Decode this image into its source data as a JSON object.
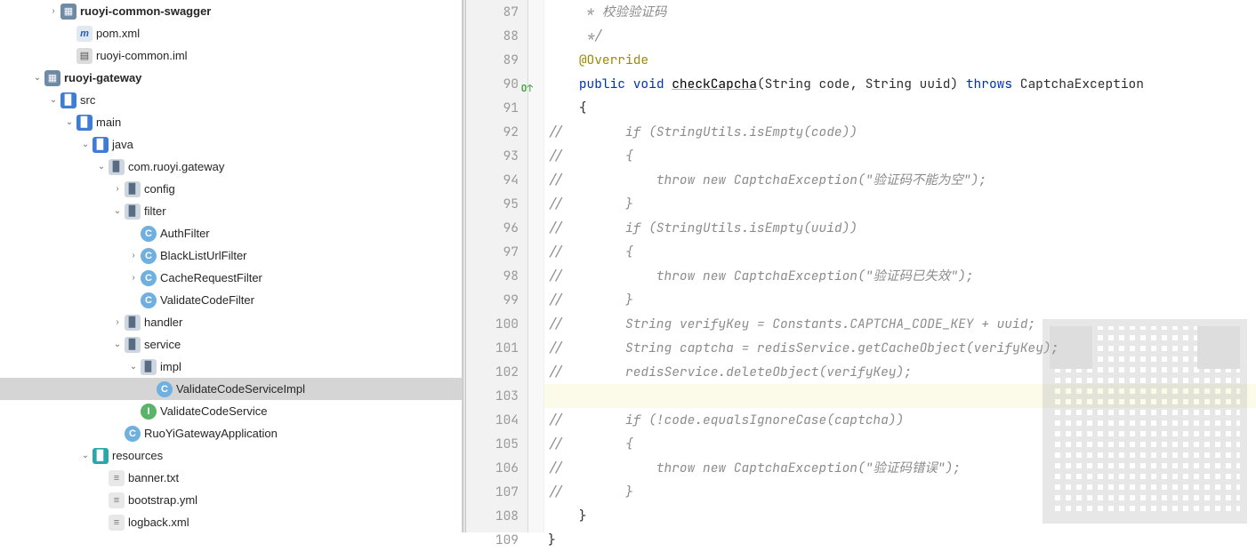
{
  "tree": {
    "nodes": [
      {
        "indent": 52,
        "arrow": "right",
        "icon": "folder-mod",
        "glyph": "▦",
        "label": "ruoyi-common-swagger",
        "bold": true,
        "interact": true
      },
      {
        "indent": 70,
        "arrow": "",
        "icon": "maven",
        "glyph": "m",
        "label": "pom.xml",
        "interact": true
      },
      {
        "indent": 70,
        "arrow": "",
        "icon": "iml",
        "glyph": "▤",
        "label": "ruoyi-common.iml",
        "interact": true
      },
      {
        "indent": 34,
        "arrow": "down",
        "icon": "folder-mod",
        "glyph": "▦",
        "label": "ruoyi-gateway",
        "bold": true,
        "interact": true
      },
      {
        "indent": 52,
        "arrow": "down",
        "icon": "folder-blue",
        "glyph": "▉",
        "label": "src",
        "interact": true
      },
      {
        "indent": 70,
        "arrow": "down",
        "icon": "folder-blue",
        "glyph": "▉",
        "label": "main",
        "interact": true
      },
      {
        "indent": 88,
        "arrow": "down",
        "icon": "folder-blue",
        "glyph": "▉",
        "label": "java",
        "interact": true
      },
      {
        "indent": 106,
        "arrow": "down",
        "icon": "folder",
        "glyph": "▉",
        "label": "com.ruoyi.gateway",
        "interact": true
      },
      {
        "indent": 124,
        "arrow": "right",
        "icon": "folder",
        "glyph": "▉",
        "label": "config",
        "interact": true
      },
      {
        "indent": 124,
        "arrow": "down",
        "icon": "folder",
        "glyph": "▉",
        "label": "filter",
        "interact": true
      },
      {
        "indent": 142,
        "arrow": "",
        "icon": "class-c",
        "glyph": "C",
        "label": "AuthFilter",
        "interact": true
      },
      {
        "indent": 142,
        "arrow": "right",
        "icon": "class-c",
        "glyph": "C",
        "label": "BlackListUrlFilter",
        "interact": true
      },
      {
        "indent": 142,
        "arrow": "right",
        "icon": "class-c",
        "glyph": "C",
        "label": "CacheRequestFilter",
        "interact": true
      },
      {
        "indent": 142,
        "arrow": "",
        "icon": "class-c",
        "glyph": "C",
        "label": "ValidateCodeFilter",
        "interact": true
      },
      {
        "indent": 124,
        "arrow": "right",
        "icon": "folder",
        "glyph": "▉",
        "label": "handler",
        "interact": true
      },
      {
        "indent": 124,
        "arrow": "down",
        "icon": "folder",
        "glyph": "▉",
        "label": "service",
        "interact": true
      },
      {
        "indent": 142,
        "arrow": "down",
        "icon": "folder",
        "glyph": "▉",
        "label": "impl",
        "interact": true
      },
      {
        "indent": 160,
        "arrow": "",
        "icon": "class-c",
        "glyph": "C",
        "label": "ValidateCodeServiceImpl",
        "interact": true,
        "selected": true
      },
      {
        "indent": 142,
        "arrow": "",
        "icon": "interface",
        "glyph": "I",
        "label": "ValidateCodeService",
        "interact": true
      },
      {
        "indent": 124,
        "arrow": "",
        "icon": "class-c",
        "glyph": "C",
        "label": "RuoYiGatewayApplication",
        "interact": true
      },
      {
        "indent": 88,
        "arrow": "down",
        "icon": "folder-teal",
        "glyph": "▉",
        "label": "resources",
        "interact": true
      },
      {
        "indent": 106,
        "arrow": "",
        "icon": "txt",
        "glyph": "≡",
        "label": "banner.txt",
        "interact": true
      },
      {
        "indent": 106,
        "arrow": "",
        "icon": "yml",
        "glyph": "≡",
        "label": "bootstrap.yml",
        "interact": true
      },
      {
        "indent": 106,
        "arrow": "",
        "icon": "yml",
        "glyph": "≡",
        "label": "logback.xml",
        "interact": true
      }
    ]
  },
  "editor": {
    "lines": [
      {
        "n": 87,
        "parts": [
          {
            "cls": "c-comment",
            "t": "     * 校验验证码"
          }
        ]
      },
      {
        "n": 88,
        "parts": [
          {
            "cls": "c-comment",
            "t": "     */"
          }
        ]
      },
      {
        "n": 89,
        "parts": [
          {
            "cls": "",
            "t": "    "
          },
          {
            "cls": "c-ann",
            "t": "@Override"
          }
        ]
      },
      {
        "n": 90,
        "ov": true,
        "parts": [
          {
            "cls": "",
            "t": "    "
          },
          {
            "cls": "c-keyword",
            "t": "public"
          },
          {
            "cls": "",
            "t": " "
          },
          {
            "cls": "c-keyword",
            "t": "void"
          },
          {
            "cls": "",
            "t": " "
          },
          {
            "cls": "c-ident und",
            "t": "checkCapcha"
          },
          {
            "cls": "",
            "t": "(String code, String uuid) "
          },
          {
            "cls": "c-keyword",
            "t": "throws"
          },
          {
            "cls": "",
            "t": " CaptchaException"
          }
        ]
      },
      {
        "n": 91,
        "parts": [
          {
            "cls": "",
            "t": "    {"
          }
        ]
      },
      {
        "n": 92,
        "parts": [
          {
            "cls": "c-comment",
            "t": "//        if (StringUtils.isEmpty(code))"
          }
        ]
      },
      {
        "n": 93,
        "parts": [
          {
            "cls": "c-comment",
            "t": "//        {"
          }
        ]
      },
      {
        "n": 94,
        "parts": [
          {
            "cls": "c-comment",
            "t": "//            throw new CaptchaException(\"验证码不能为空\");"
          }
        ]
      },
      {
        "n": 95,
        "parts": [
          {
            "cls": "c-comment",
            "t": "//        }"
          }
        ]
      },
      {
        "n": 96,
        "parts": [
          {
            "cls": "c-comment",
            "t": "//        if (StringUtils.isEmpty(uuid))"
          }
        ]
      },
      {
        "n": 97,
        "parts": [
          {
            "cls": "c-comment",
            "t": "//        {"
          }
        ]
      },
      {
        "n": 98,
        "parts": [
          {
            "cls": "c-comment",
            "t": "//            throw new CaptchaException(\"验证码已失效\");"
          }
        ]
      },
      {
        "n": 99,
        "parts": [
          {
            "cls": "c-comment",
            "t": "//        }"
          }
        ]
      },
      {
        "n": 100,
        "parts": [
          {
            "cls": "c-comment",
            "t": "//        String verifyKey = Constants.CAPTCHA_CODE_KEY + uuid;"
          }
        ]
      },
      {
        "n": 101,
        "parts": [
          {
            "cls": "c-comment",
            "t": "//        String captcha = redisService.getCacheObject(verifyKey);"
          }
        ]
      },
      {
        "n": 102,
        "parts": [
          {
            "cls": "c-comment",
            "t": "//        redisService.deleteObject(verifyKey);"
          }
        ]
      },
      {
        "n": 103,
        "hl": true,
        "parts": [
          {
            "cls": "",
            "t": ""
          }
        ]
      },
      {
        "n": 104,
        "parts": [
          {
            "cls": "c-comment",
            "t": "//        if (!code.equalsIgnoreCase(captcha))"
          }
        ]
      },
      {
        "n": 105,
        "parts": [
          {
            "cls": "c-comment",
            "t": "//        {"
          }
        ]
      },
      {
        "n": 106,
        "parts": [
          {
            "cls": "c-comment",
            "t": "//            throw new CaptchaException(\"验证码错误\");"
          }
        ]
      },
      {
        "n": 107,
        "parts": [
          {
            "cls": "c-comment",
            "t": "//        }"
          }
        ]
      },
      {
        "n": 108,
        "parts": [
          {
            "cls": "",
            "t": "    }"
          }
        ]
      },
      {
        "n": 109,
        "parts": [
          {
            "cls": "",
            "t": "}"
          }
        ]
      }
    ]
  }
}
